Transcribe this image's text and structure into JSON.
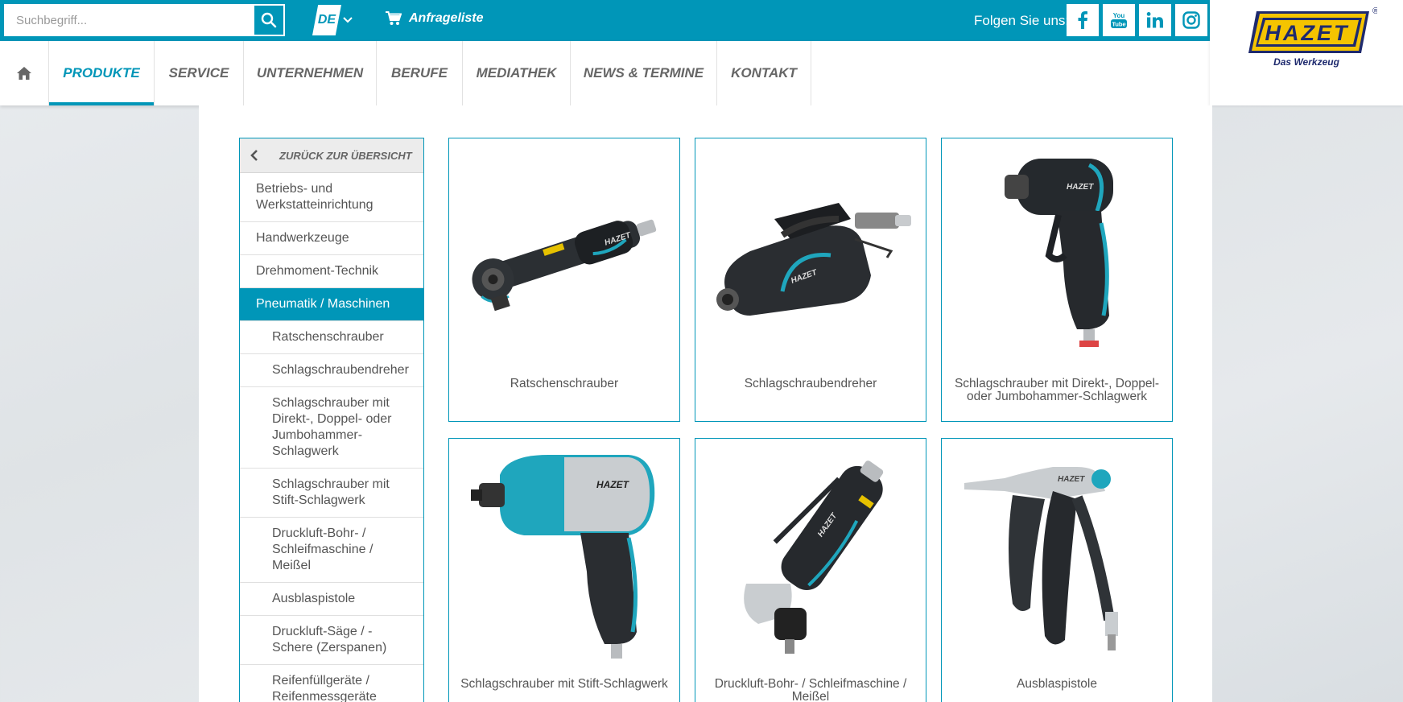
{
  "search": {
    "placeholder": "Suchbegriff..."
  },
  "language": {
    "code": "DE"
  },
  "cart": {
    "label": "Anfrageliste"
  },
  "social": {
    "label": "Folgen Sie uns:",
    "items": [
      {
        "name": "facebook",
        "text": "f"
      },
      {
        "name": "youtube",
        "text": "You Tube"
      },
      {
        "name": "linkedin",
        "text": "in"
      },
      {
        "name": "instagram",
        "text": ""
      }
    ]
  },
  "nav": {
    "items": [
      {
        "label": "PRODUKTE",
        "active": true
      },
      {
        "label": "SERVICE"
      },
      {
        "label": "UNTERNEHMEN"
      },
      {
        "label": "BERUFE"
      },
      {
        "label": "MEDIATHEK"
      },
      {
        "label": "NEWS & TERMINE"
      },
      {
        "label": "KONTAKT"
      }
    ]
  },
  "logo": {
    "brand": "HAZET",
    "tagline": "Das Werkzeug",
    "registered": "®"
  },
  "sidebar": {
    "back_label": "ZURÜCK ZUR ÜBERSICHT",
    "items": [
      {
        "label": "Betriebs- und Werkstatteinrichtung"
      },
      {
        "label": "Handwerkzeuge"
      },
      {
        "label": "Drehmoment-Technik"
      },
      {
        "label": "Pneumatik / Maschinen",
        "active": true
      },
      {
        "label": "Ratschenschrauber",
        "sub": true
      },
      {
        "label": "Schlagschraubendreher",
        "sub": true
      },
      {
        "label": "Schlagschrauber mit Direkt-, Doppel- oder Jumbohammer-Schlagwerk",
        "sub": true
      },
      {
        "label": "Schlagschrauber mit Stift-Schlagwerk",
        "sub": true
      },
      {
        "label": "Druckluft-Bohr- / Schleifmaschine / Meißel",
        "sub": true
      },
      {
        "label": "Ausblaspistole",
        "sub": true
      },
      {
        "label": "Druckluft-Säge / -Schere (Zerspanen)",
        "sub": true
      },
      {
        "label": "Reifenfüllgeräte / Reifenmessgeräte",
        "sub": true
      }
    ]
  },
  "products": [
    {
      "label": "Ratschenschrauber"
    },
    {
      "label": "Schlagschraubendreher"
    },
    {
      "label": "Schlagschrauber mit Direkt-, Doppel- oder Jumbohammer-Schlagwerk"
    },
    {
      "label": "Schlagschrauber mit Stift-Schlagwerk"
    },
    {
      "label": "Druckluft-Bohr- / Schleifmaschine / Meißel"
    },
    {
      "label": "Ausblaspistole"
    }
  ],
  "colors": {
    "accent": "#0096b8",
    "logo_yellow": "#f5c400",
    "logo_navy": "#1e2a6e"
  }
}
